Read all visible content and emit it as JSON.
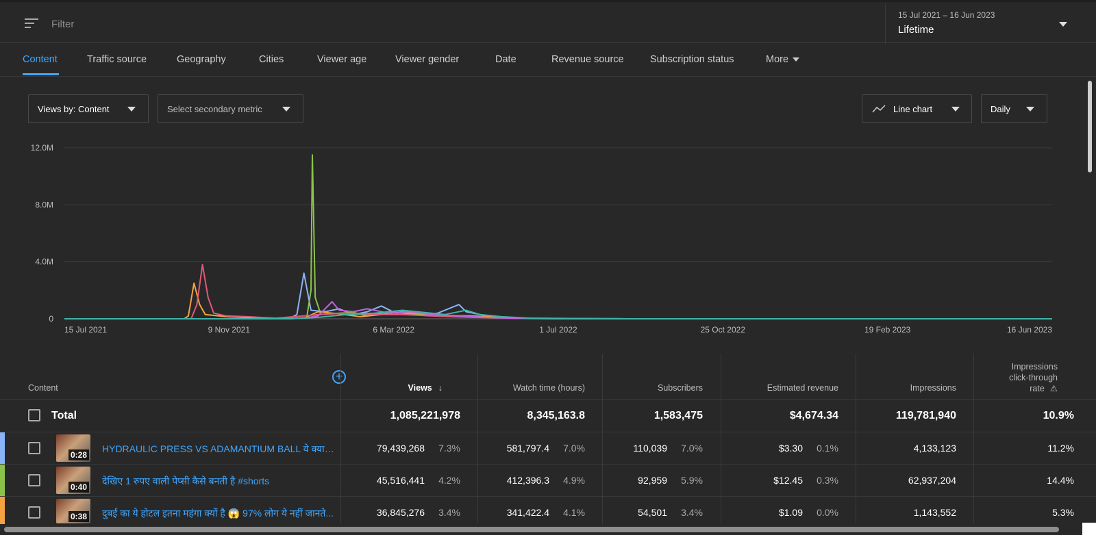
{
  "filter": {
    "placeholder": "Filter",
    "icon": "filter-icon"
  },
  "date": {
    "range": "15 Jul 2021 – 16 Jun 2023",
    "label": "Lifetime"
  },
  "tabs": [
    "Content",
    "Traffic source",
    "Geography",
    "Cities",
    "Viewer age",
    "Viewer gender",
    "Date",
    "Revenue source",
    "Subscription status",
    "More"
  ],
  "controls": {
    "primary_metric": "Views by: Content",
    "secondary_metric": "Select secondary metric",
    "chart_type": "Line chart",
    "granularity": "Daily"
  },
  "chart_data": {
    "type": "line",
    "y_ticks": [
      "12.0M",
      "8.0M",
      "4.0M",
      "0"
    ],
    "x_ticks": [
      "15 Jul 2021",
      "9 Nov 2021",
      "6 Mar 2022",
      "1 Jul 2022",
      "25 Oct 2022",
      "19 Feb 2023",
      "16 Jun 2023"
    ],
    "ylim": [
      0,
      12000000
    ],
    "grid": true,
    "x_range_days": [
      0,
      701
    ],
    "series": [
      {
        "color": "#8ab4f8",
        "points": [
          [
            0,
            0
          ],
          [
            80,
            0
          ],
          [
            130,
            0
          ],
          [
            135,
            60000
          ],
          [
            160,
            40000
          ],
          [
            165,
            300000
          ],
          [
            170,
            3200000
          ],
          [
            175,
            600000
          ],
          [
            185,
            500000
          ],
          [
            195,
            700000
          ],
          [
            205,
            300000
          ],
          [
            215,
            500000
          ],
          [
            225,
            900000
          ],
          [
            235,
            400000
          ],
          [
            250,
            500000
          ],
          [
            255,
            250000
          ],
          [
            265,
            400000
          ],
          [
            275,
            800000
          ],
          [
            280,
            1000000
          ],
          [
            285,
            500000
          ],
          [
            300,
            200000
          ],
          [
            330,
            30000
          ],
          [
            400,
            0
          ],
          [
            701,
            0
          ]
        ]
      },
      {
        "color": "#8bc34a",
        "points": [
          [
            0,
            0
          ],
          [
            140,
            0
          ],
          [
            160,
            0
          ],
          [
            172,
            80000
          ],
          [
            175,
            2000000
          ],
          [
            176,
            11500000
          ],
          [
            178,
            1500000
          ],
          [
            182,
            300000
          ],
          [
            195,
            400000
          ],
          [
            205,
            450000
          ],
          [
            215,
            200000
          ],
          [
            230,
            500000
          ],
          [
            250,
            300000
          ],
          [
            270,
            200000
          ],
          [
            300,
            150000
          ],
          [
            320,
            50000
          ],
          [
            360,
            0
          ],
          [
            701,
            0
          ]
        ]
      },
      {
        "color": "#f4a340",
        "points": [
          [
            0,
            0
          ],
          [
            85,
            0
          ],
          [
            88,
            200000
          ],
          [
            92,
            2500000
          ],
          [
            96,
            1000000
          ],
          [
            100,
            300000
          ],
          [
            115,
            150000
          ],
          [
            130,
            80000
          ],
          [
            150,
            0
          ],
          [
            170,
            50000
          ],
          [
            180,
            500000
          ],
          [
            195,
            350000
          ],
          [
            210,
            150000
          ],
          [
            225,
            300000
          ],
          [
            240,
            500000
          ],
          [
            260,
            250000
          ],
          [
            290,
            200000
          ],
          [
            320,
            50000
          ],
          [
            350,
            0
          ],
          [
            701,
            0
          ]
        ]
      },
      {
        "color": "#e05a7a",
        "points": [
          [
            0,
            0
          ],
          [
            90,
            0
          ],
          [
            94,
            1000000
          ],
          [
            98,
            3800000
          ],
          [
            102,
            1500000
          ],
          [
            106,
            400000
          ],
          [
            115,
            200000
          ],
          [
            130,
            150000
          ],
          [
            150,
            50000
          ],
          [
            170,
            200000
          ],
          [
            180,
            300000
          ],
          [
            200,
            400000
          ],
          [
            220,
            300000
          ],
          [
            240,
            300000
          ],
          [
            260,
            200000
          ],
          [
            290,
            100000
          ],
          [
            330,
            20000
          ],
          [
            400,
            0
          ],
          [
            701,
            0
          ]
        ]
      },
      {
        "color": "#c063e0",
        "points": [
          [
            0,
            0
          ],
          [
            150,
            0
          ],
          [
            170,
            50000
          ],
          [
            180,
            200000
          ],
          [
            190,
            1200000
          ],
          [
            195,
            600000
          ],
          [
            205,
            500000
          ],
          [
            215,
            700000
          ],
          [
            230,
            400000
          ],
          [
            245,
            500000
          ],
          [
            260,
            300000
          ],
          [
            280,
            200000
          ],
          [
            300,
            100000
          ],
          [
            320,
            30000
          ],
          [
            360,
            0
          ],
          [
            701,
            0
          ]
        ]
      },
      {
        "color": "#3fb4a6",
        "points": [
          [
            0,
            0
          ],
          [
            160,
            0
          ],
          [
            180,
            100000
          ],
          [
            200,
            300000
          ],
          [
            220,
            400000
          ],
          [
            240,
            600000
          ],
          [
            250,
            500000
          ],
          [
            270,
            300000
          ],
          [
            285,
            600000
          ],
          [
            295,
            300000
          ],
          [
            310,
            150000
          ],
          [
            330,
            50000
          ],
          [
            400,
            0
          ],
          [
            701,
            0
          ]
        ]
      }
    ]
  },
  "table": {
    "headers": {
      "content": "Content",
      "views": "Views",
      "watch_time": "Watch time (hours)",
      "subscribers": "Subscribers",
      "revenue": "Estimated revenue",
      "impressions": "Impressions",
      "ctr_line1": "Impressions",
      "ctr_line2": "click-through",
      "ctr_line3": "rate"
    },
    "total": {
      "label": "Total",
      "views": "1,085,221,978",
      "watch_time": "8,345,163.8",
      "subscribers": "1,583,475",
      "revenue": "$4,674.34",
      "impressions": "119,781,940",
      "ctr": "10.9%"
    },
    "rows": [
      {
        "color": "#8ab4f8",
        "duration": "0:28",
        "title": "HYDRAULIC PRESS VS ADAMANTIUM BALL ये क्या हो ग...",
        "views": "79,439,268",
        "views_pct": "7.3%",
        "watch_time": "581,797.4",
        "watch_pct": "7.0%",
        "subscribers": "110,039",
        "subs_pct": "7.0%",
        "revenue": "$3.30",
        "rev_pct": "0.1%",
        "impressions": "4,133,123",
        "ctr": "11.2%"
      },
      {
        "color": "#8bc34a",
        "duration": "0:40",
        "title": "देखिए 1 रुपए वाली पेप्सी कैसे बनती है #shorts",
        "views": "45,516,441",
        "views_pct": "4.2%",
        "watch_time": "412,396.3",
        "watch_pct": "4.9%",
        "subscribers": "92,959",
        "subs_pct": "5.9%",
        "revenue": "$12.45",
        "rev_pct": "0.3%",
        "impressions": "62,937,204",
        "ctr": "14.4%"
      },
      {
        "color": "#f4a340",
        "duration": "0:38",
        "title": "दुबई का ये होटल इतना महंगा क्यों है 😱 97% लोग ये नहीं जानते...",
        "views": "36,845,276",
        "views_pct": "3.4%",
        "watch_time": "341,422.4",
        "watch_pct": "4.1%",
        "subscribers": "54,501",
        "subs_pct": "3.4%",
        "revenue": "$1.09",
        "rev_pct": "0.0%",
        "impressions": "1,143,552",
        "ctr": "5.3%"
      }
    ]
  }
}
